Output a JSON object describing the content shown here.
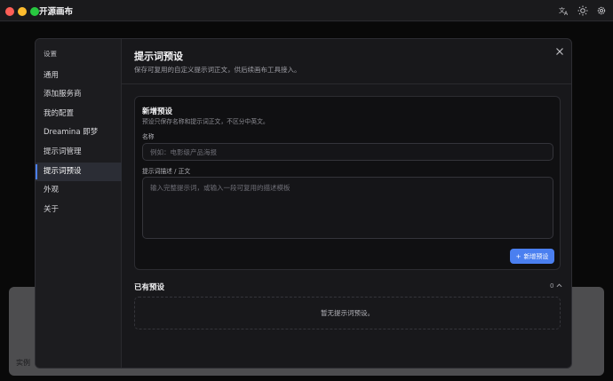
{
  "app": {
    "title": "开源画布"
  },
  "background": {
    "item_label": "实例"
  },
  "settings": {
    "heading": "设置",
    "nav": [
      {
        "label": "通用"
      },
      {
        "label": "添加服务商"
      },
      {
        "label": "我的配置"
      },
      {
        "label": "Dreamina 即梦"
      },
      {
        "label": "提示词管理"
      },
      {
        "label": "提示词预设",
        "active": true
      },
      {
        "label": "外观"
      },
      {
        "label": "关于"
      }
    ]
  },
  "panel": {
    "title": "提示词预设",
    "subtitle": "保存可复用的自定义提示词正文，供后续画布工具接入。",
    "new_preset": {
      "title": "新增预设",
      "subtitle": "预设只保存名称和提示词正文，不区分中英文。",
      "name_label": "名称",
      "name_placeholder": "例如：电影级产品海报",
      "name_value": "",
      "prompt_label": "提示词描述 / 正文",
      "prompt_placeholder": "输入完整提示词，或输入一段可复用的描述模板",
      "prompt_value": "",
      "add_button_label": "新增预设"
    },
    "existing": {
      "title": "已有预设",
      "count": "0",
      "empty_text": "暂无提示词预设。"
    }
  },
  "colors": {
    "accent": "#4a7ff0",
    "modal_bg": "#18181b",
    "sidebar_bg": "#1c1c1f"
  }
}
